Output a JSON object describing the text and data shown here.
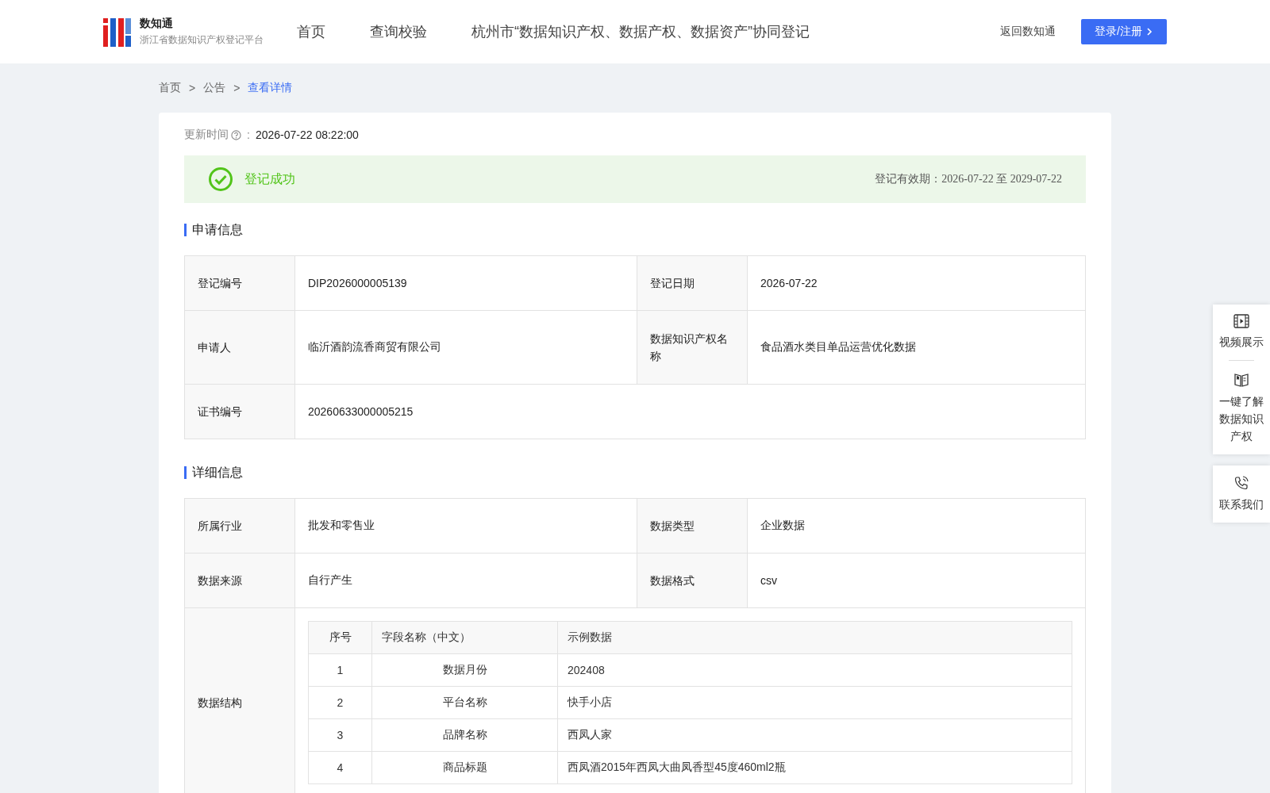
{
  "header": {
    "logo": {
      "name": "数知通",
      "subtitle": "浙江省数据知识产权登记平台"
    },
    "nav": [
      {
        "label": "首页",
        "selected": false
      },
      {
        "label": "查询校验",
        "selected": false
      },
      {
        "label": "杭州市“数据知识产权、数据产权、数据资产”协同登记",
        "selected": false
      }
    ],
    "back_link": "返回数知通",
    "login_button": "登录/注册"
  },
  "breadcrumb_separator": ">",
  "breadcrumb": [
    {
      "label": "首页",
      "selected": false
    },
    {
      "label": "公告",
      "selected": false
    },
    {
      "label": "查看详情",
      "selected": true
    }
  ],
  "update": {
    "label": "更新时间",
    "colon": ":",
    "value": "2026-07-22 08:22:00"
  },
  "status": {
    "kind": "success",
    "text": "登记成功",
    "validity": "登记有效期：2026-07-22 至 2029-07-22"
  },
  "application": {
    "title": "申请信息",
    "rows": [
      [
        {
          "label": "登记编号",
          "value": "DIP2026000005139"
        },
        {
          "label": "登记日期",
          "value": "2026-07-22"
        }
      ],
      [
        {
          "label": "申请人",
          "value": "临沂酒韵流香商贸有限公司"
        },
        {
          "label": "数据知识产权名称",
          "value": "食品酒水类目单品运营优化数据"
        }
      ],
      [
        {
          "label": "证书编号",
          "value": "20260633000005215"
        }
      ]
    ]
  },
  "details": {
    "title": "详细信息",
    "rows": [
      [
        {
          "label": "所属行业",
          "value": "批发和零售业"
        },
        {
          "label": "数据类型",
          "value": "企业数据"
        }
      ],
      [
        {
          "label": "数据来源",
          "value": "自行产生"
        },
        {
          "label": "数据格式",
          "value": "csv"
        }
      ]
    ],
    "structure": {
      "label": "数据结构",
      "columns": [
        "序号",
        "字段名称（中文）",
        "示例数据"
      ],
      "rows": [
        [
          "1",
          "数据月份",
          "202408"
        ],
        [
          "2",
          "平台名称",
          "快手小店"
        ],
        [
          "3",
          "品牌名称",
          "西凤人家"
        ],
        [
          "4",
          "商品标题",
          "西凤酒2015年西凤大曲凤香型45度460ml2瓶"
        ]
      ]
    }
  },
  "side_panel": [
    {
      "kind": "video",
      "label": "视频展示"
    },
    {
      "kind": "book",
      "label": "一键了解数据知识产权"
    },
    {
      "kind": "phone",
      "label": "联系我们"
    }
  ]
}
